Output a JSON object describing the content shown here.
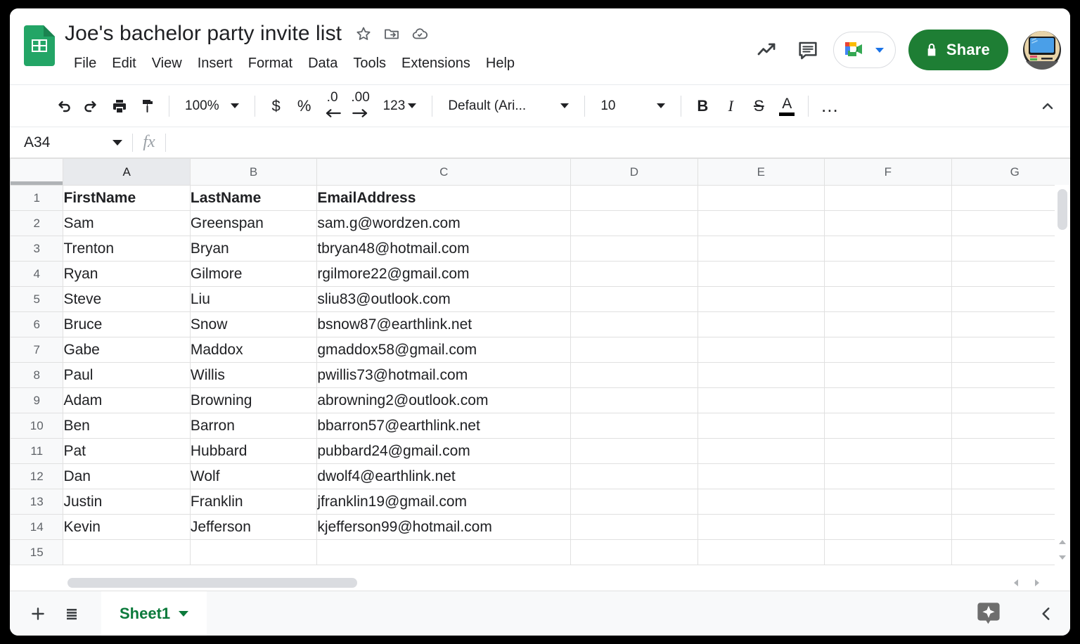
{
  "app": {
    "name": "Google Sheets",
    "logo_icon": "sheets-logo-icon",
    "doc_title": "Joe's bachelor party invite list"
  },
  "title_icons": [
    {
      "name": "star-icon",
      "label": "Star"
    },
    {
      "name": "move-to-folder-icon",
      "label": "Move"
    },
    {
      "name": "cloud-saved-icon",
      "label": "Saved to Drive"
    }
  ],
  "menubar": {
    "items": [
      {
        "label": "File"
      },
      {
        "label": "Edit"
      },
      {
        "label": "View"
      },
      {
        "label": "Insert"
      },
      {
        "label": "Format"
      },
      {
        "label": "Data"
      },
      {
        "label": "Tools"
      },
      {
        "label": "Extensions"
      },
      {
        "label": "Help"
      }
    ]
  },
  "header_right": {
    "trends_icon": "trending-up-icon",
    "comment_icon": "comment-icon",
    "meet_icon": "google-meet-icon",
    "meet_caret_icon": "chevron-down-icon",
    "share_label": "Share",
    "share_lock_icon": "lock-icon",
    "share_color": "#1e7e34",
    "avatar_icon": "user-avatar"
  },
  "toolbar": {
    "undo_icon": "undo-icon",
    "redo_icon": "redo-icon",
    "print_icon": "print-icon",
    "paint_icon": "paint-format-icon",
    "zoom_value": "100%",
    "currency_label": "$",
    "percent_label": "%",
    "decrease_decimal_label": ".0",
    "increase_decimal_label": ".00",
    "number_format_label": "123",
    "font_value": "Default (Ari...",
    "font_size_value": "10",
    "bold_label": "B",
    "italic_label": "I",
    "strikethrough_label": "S",
    "text_color_label": "A",
    "text_color_swatch": "#000000",
    "more_label": "…",
    "collapse_icon": "chevron-up-icon"
  },
  "formula_bar": {
    "name_box_value": "A34",
    "name_box_caret_icon": "chevron-down-icon",
    "fx_label": "fx",
    "formula_value": "",
    "formula_placeholder": ""
  },
  "grid": {
    "columns": [
      "A",
      "B",
      "C",
      "D",
      "E",
      "F",
      "G"
    ],
    "selected_column": "A",
    "rows": [
      {
        "num": "1",
        "cells": [
          "FirstName",
          "LastName",
          "EmailAddress",
          "",
          "",
          "",
          ""
        ],
        "header": true
      },
      {
        "num": "2",
        "cells": [
          "Sam",
          "Greenspan",
          "sam.g@wordzen.com",
          "",
          "",
          "",
          ""
        ]
      },
      {
        "num": "3",
        "cells": [
          "Trenton",
          "Bryan",
          "tbryan48@hotmail.com",
          "",
          "",
          "",
          ""
        ]
      },
      {
        "num": "4",
        "cells": [
          "Ryan",
          "Gilmore",
          "rgilmore22@gmail.com",
          "",
          "",
          "",
          ""
        ]
      },
      {
        "num": "5",
        "cells": [
          "Steve",
          "Liu",
          "sliu83@outlook.com",
          "",
          "",
          "",
          ""
        ]
      },
      {
        "num": "6",
        "cells": [
          "Bruce",
          "Snow",
          "bsnow87@earthlink.net",
          "",
          "",
          "",
          ""
        ]
      },
      {
        "num": "7",
        "cells": [
          "Gabe",
          "Maddox",
          "gmaddox58@gmail.com",
          "",
          "",
          "",
          ""
        ]
      },
      {
        "num": "8",
        "cells": [
          "Paul",
          "Willis",
          "pwillis73@hotmail.com",
          "",
          "",
          "",
          ""
        ]
      },
      {
        "num": "9",
        "cells": [
          "Adam",
          "Browning",
          "abrowning2@outlook.com",
          "",
          "",
          "",
          ""
        ]
      },
      {
        "num": "10",
        "cells": [
          "Ben",
          "Barron",
          "bbarron57@earthlink.net",
          "",
          "",
          "",
          ""
        ]
      },
      {
        "num": "11",
        "cells": [
          "Pat",
          "Hubbard",
          "pubbard24@gmail.com",
          "",
          "",
          "",
          ""
        ]
      },
      {
        "num": "12",
        "cells": [
          "Dan",
          "Wolf",
          "dwolf4@earthlink.net",
          "",
          "",
          "",
          ""
        ]
      },
      {
        "num": "13",
        "cells": [
          "Justin",
          "Franklin",
          "jfranklin19@gmail.com",
          "",
          "",
          "",
          ""
        ]
      },
      {
        "num": "14",
        "cells": [
          "Kevin",
          "Jefferson",
          "kjefferson99@hotmail.com",
          "",
          "",
          "",
          ""
        ]
      },
      {
        "num": "15",
        "cells": [
          "",
          "",
          "",
          "",
          "",
          "",
          ""
        ]
      }
    ]
  },
  "sheetbar": {
    "add_sheet_icon": "plus-icon",
    "all_sheets_icon": "all-sheets-icon",
    "tab_label": "Sheet1",
    "tab_caret_icon": "chevron-down-icon",
    "tab_color": "#0b7a3b",
    "explore_icon": "explore-sparkle-icon",
    "collapse_icon": "chevron-left-icon"
  }
}
